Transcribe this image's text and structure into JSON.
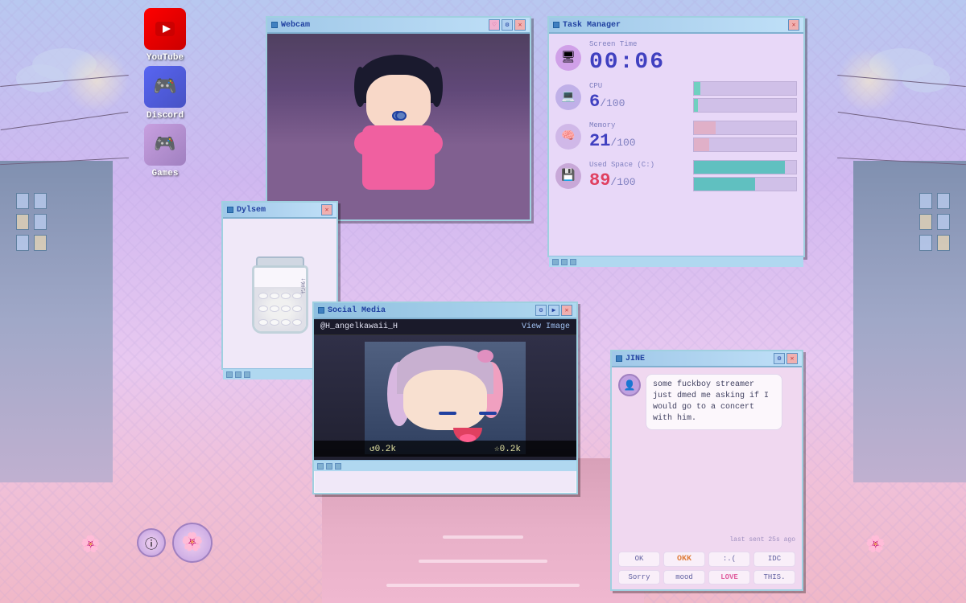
{
  "background": {
    "color": "#c8a8e9"
  },
  "desktop_icons": [
    {
      "id": "youtube",
      "label": "YouTube",
      "emoji": "▶",
      "color_from": "#ff0000",
      "color_to": "#cc0000"
    },
    {
      "id": "discord",
      "label": "Discord",
      "emoji": "💬",
      "color_from": "#5865f2",
      "color_to": "#4752c4"
    },
    {
      "id": "games",
      "label": "Games",
      "emoji": "🎮",
      "color_from": "#c8a0e0",
      "color_to": "#a080c0"
    }
  ],
  "windows": {
    "webcam": {
      "title": "Webcam",
      "buttons": [
        "♡",
        "⚙",
        "✕"
      ]
    },
    "taskmanager": {
      "title": "Task Manager",
      "screen_time_label": "Screen Time",
      "screen_time_value": "00:06",
      "cpu_label": "CPU",
      "cpu_value": "6",
      "cpu_max": "100",
      "cpu_percent": 6,
      "memory_label": "Memory",
      "memory_value": "21",
      "memory_max": "100",
      "memory_percent": 21,
      "disk_label": "Used Space (C:)",
      "disk_value": "89",
      "disk_max": "100",
      "disk_percent": 89
    },
    "dylsem": {
      "title": "Dylsem",
      "label_text": "さま↑"
    },
    "socialmedia": {
      "title": "Social Media",
      "username": "@H_angelkawaii_H",
      "view_image_label": "View Image",
      "likes": "↺0.2k",
      "stars": "☆0.2k"
    },
    "jine": {
      "title": "JINE",
      "message": "some fuckboy streamer just dmed me asking if I would go to a concert with him.",
      "timestamp": "last sent 25s ago",
      "reactions": [
        "OK",
        "OKK",
        ":.(",
        "IDC",
        "Sorry",
        "mood",
        "LOVE",
        "THIS."
      ]
    }
  },
  "taskbar": {
    "items": [
      {
        "id": "notif",
        "emoji": "ⓘ"
      },
      {
        "id": "char",
        "emoji": "👤"
      }
    ]
  }
}
